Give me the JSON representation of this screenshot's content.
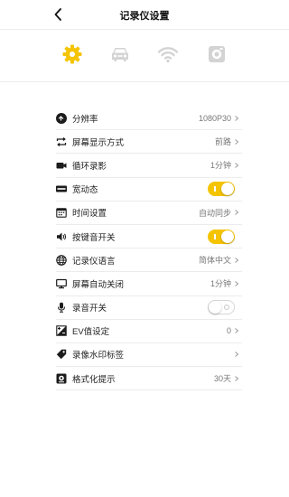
{
  "header": {
    "title": "记录仪设置",
    "back_icon": "chevron-left-icon"
  },
  "tabs": [
    {
      "name": "settings",
      "icon": "gear-icon",
      "active": true
    },
    {
      "name": "car",
      "icon": "car-icon",
      "active": false
    },
    {
      "name": "wifi",
      "icon": "wifi-icon",
      "active": false
    },
    {
      "name": "storage",
      "icon": "sd-card-icon",
      "active": false
    }
  ],
  "colors": {
    "accent": "#f5c400",
    "inactive_icon": "#d3d3d3",
    "text": "#222222",
    "value_text": "#777777",
    "divider": "#ececec"
  },
  "settings": {
    "items": [
      {
        "label": "分辨率",
        "value": "1080P30",
        "icon": "resolution-icon",
        "control": "chevron"
      },
      {
        "label": "屏幕显示方式",
        "value": "前路",
        "icon": "screen-switch-icon",
        "control": "chevron"
      },
      {
        "label": "循环录影",
        "value": "1分钟",
        "icon": "video-camera-icon",
        "control": "chevron"
      },
      {
        "label": "宽动态",
        "value": "",
        "icon": "wdr-icon",
        "control": "toggle",
        "on": true
      },
      {
        "label": "时间设置",
        "value": "自动同步",
        "icon": "calendar-icon",
        "control": "chevron"
      },
      {
        "label": "按键音开关",
        "value": "",
        "icon": "speaker-icon",
        "control": "toggle",
        "on": true
      },
      {
        "label": "记录仪语言",
        "value": "简体中文",
        "icon": "globe-icon",
        "control": "chevron"
      },
      {
        "label": "屏幕自动关闭",
        "value": "1分钟",
        "icon": "monitor-icon",
        "control": "chevron"
      },
      {
        "label": "录音开关",
        "value": "",
        "icon": "microphone-icon",
        "control": "toggle",
        "on": false
      },
      {
        "label": "EV值设定",
        "value": "0",
        "icon": "exposure-icon",
        "control": "chevron"
      },
      {
        "label": "录像水印标签",
        "value": "",
        "icon": "watermark-tag-icon",
        "control": "chevron"
      },
      {
        "label": "格式化提示",
        "value": "30天",
        "icon": "format-reminder-icon",
        "control": "chevron"
      }
    ]
  }
}
